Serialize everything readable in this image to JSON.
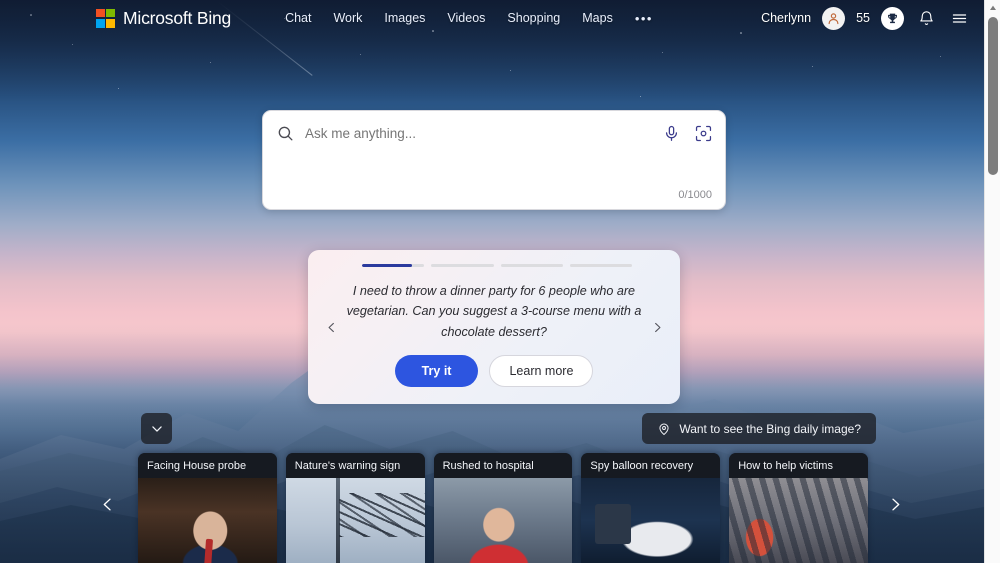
{
  "header": {
    "brand": "Microsoft Bing",
    "nav": [
      {
        "label": "Chat"
      },
      {
        "label": "Work"
      },
      {
        "label": "Images"
      },
      {
        "label": "Videos"
      },
      {
        "label": "Shopping"
      },
      {
        "label": "Maps"
      },
      {
        "label": "•••"
      }
    ],
    "user_name": "Cherlynn",
    "rewards_points": "55"
  },
  "search": {
    "placeholder": "Ask me anything...",
    "value": "",
    "counter": "0/1000"
  },
  "suggestion": {
    "progress": [
      {
        "fill": 80
      },
      {
        "fill": 0
      },
      {
        "fill": 0
      },
      {
        "fill": 0
      }
    ],
    "text": "I need to throw a dinner party for 6 people who are vegetarian. Can you suggest a 3-course menu with a chocolate dessert?",
    "try_label": "Try it",
    "learn_label": "Learn more"
  },
  "daily_image": {
    "label": "Want to see the Bing daily image?"
  },
  "news": {
    "cards": [
      {
        "title": "Facing House probe",
        "photo": "ph1"
      },
      {
        "title": "Nature's warning sign",
        "photo": "ph2"
      },
      {
        "title": "Rushed to hospital",
        "photo": "ph3"
      },
      {
        "title": "Spy balloon recovery",
        "photo": "ph4"
      },
      {
        "title": "How to help victims",
        "photo": "ph5"
      }
    ]
  },
  "colors": {
    "accent_blue": "#2d55e0",
    "progress_active": "#2b3a9e",
    "pill_dark": "rgba(26,28,33,.76)",
    "logo_red": "#f25022",
    "logo_green": "#7fba00",
    "logo_blue": "#00a4ef",
    "logo_yellow": "#ffb900"
  }
}
